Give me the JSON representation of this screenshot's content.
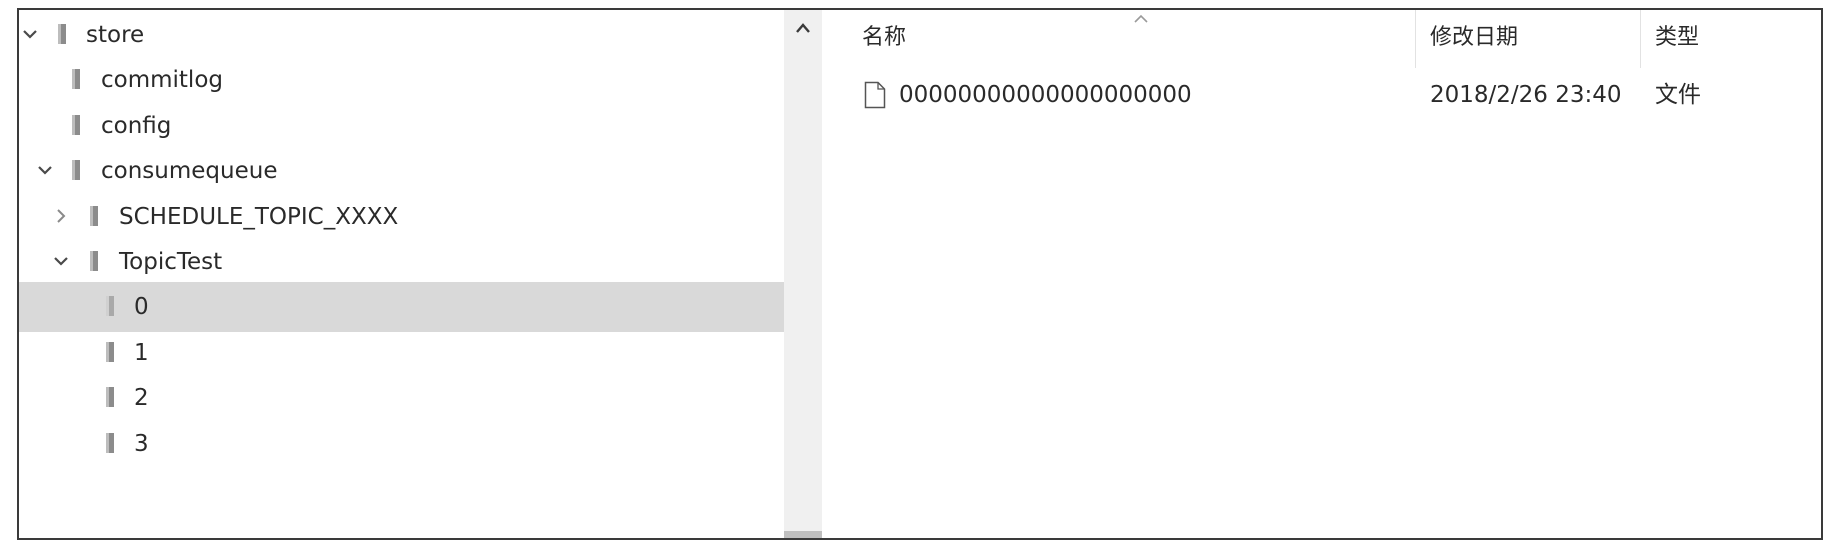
{
  "tree": {
    "items": [
      {
        "label": "store",
        "expand_state": "expanded"
      },
      {
        "label": "commitlog",
        "expand_state": "none"
      },
      {
        "label": "config",
        "expand_state": "none"
      },
      {
        "label": "consumequeue",
        "expand_state": "expanded"
      },
      {
        "label": "SCHEDULE_TOPIC_XXXX",
        "expand_state": "collapsed"
      },
      {
        "label": "TopicTest",
        "expand_state": "expanded"
      },
      {
        "label": "0",
        "expand_state": "none",
        "selected": true
      },
      {
        "label": "1",
        "expand_state": "none"
      },
      {
        "label": "2",
        "expand_state": "none"
      },
      {
        "label": "3",
        "expand_state": "none"
      }
    ]
  },
  "file_list": {
    "sort_indicator": "sort-ascending-icon",
    "columns": [
      "名称",
      "修改日期",
      "类型"
    ],
    "rows": [
      {
        "name": "00000000000000000000",
        "modified": "2018/2/26 23:40",
        "type": "文件"
      }
    ]
  },
  "colors": {
    "selected_row": "#d9d9d9",
    "frame_border": "#3a3a3a",
    "scrollbar_track": "#f0f0f0"
  }
}
